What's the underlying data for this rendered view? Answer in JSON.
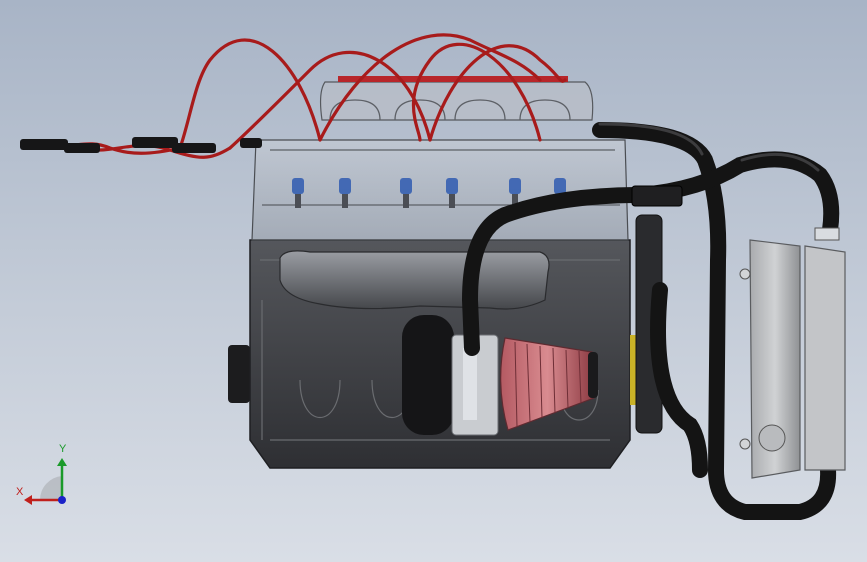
{
  "viewport": {
    "background_colors": [
      "#a8b4c6",
      "#d9dee6"
    ],
    "model": "engine-assembly"
  },
  "triad": {
    "y_label": "Y",
    "x_label": "X",
    "y_color": "#1a9a2a",
    "x_color": "#c0201c",
    "z_color": "#1a22c8"
  },
  "colors": {
    "ignition_wire": "#a81b1b",
    "engine_block": "#3d3e42",
    "hoses": "#151515",
    "air_filter": "#c66e74",
    "spark_plug_tip": "#3b6fd0",
    "mount_yellow": "#c9b227"
  }
}
